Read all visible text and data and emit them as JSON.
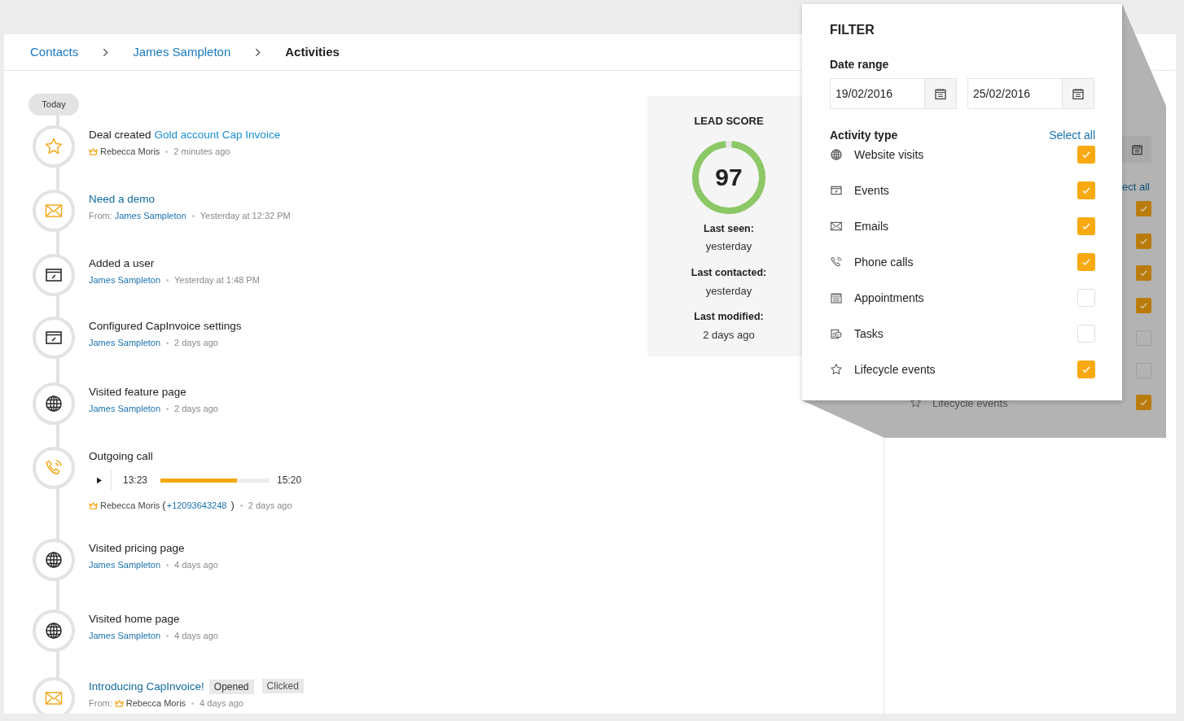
{
  "breadcrumb": [
    {
      "label": "Contacts",
      "kind": "link"
    },
    {
      "label": "James Sampleton",
      "kind": "link"
    },
    {
      "label": "Activities",
      "kind": "current"
    }
  ],
  "timeline": {
    "date_label": "Today",
    "activities": [
      {
        "kind": "deal",
        "title": "Deal created",
        "title_link": "Gold account Cap Invoice",
        "person": {
          "name": "Rebecca Moris",
          "kind": "user"
        },
        "time": "2 minutes ago"
      },
      {
        "kind": "email",
        "title_link": "Need a demo",
        "from_label": "From:",
        "person": {
          "name": "James Sampleton",
          "kind": "contact"
        },
        "time": "Yesterday at 12:32 PM"
      },
      {
        "kind": "event",
        "title": "Added a user",
        "person": {
          "name": "James Sampleton",
          "kind": "contact"
        },
        "time": "Yesterday at 1:48 PM"
      },
      {
        "kind": "event",
        "title": "Configured CapInvoice settings",
        "person": {
          "name": "James Sampleton",
          "kind": "contact"
        },
        "time": "2 days ago"
      },
      {
        "kind": "visit",
        "title": "Visited feature page",
        "person": {
          "name": "James Sampleton",
          "kind": "contact"
        },
        "time": "2 days ago"
      },
      {
        "kind": "call",
        "title": "Outgoing call",
        "call": {
          "start": "13:23",
          "level": 0.7,
          "end": "15:20"
        },
        "person": {
          "name": "Rebecca Moris",
          "kind": "user"
        },
        "phone_open": "(",
        "phone": "+12093643248",
        "phone_close": ")",
        "time": "2 days ago"
      },
      {
        "kind": "visit",
        "title": "Visited pricing page",
        "person": {
          "name": "James Sampleton",
          "kind": "contact"
        },
        "time": "4 days ago"
      },
      {
        "kind": "visit",
        "title": "Visited home  page",
        "person": {
          "name": "James Sampleton",
          "kind": "contact"
        },
        "time": "4 days ago"
      },
      {
        "kind": "email",
        "title_link": "Introducing CapInvoice!",
        "badges": [
          "Opened",
          "Clicked"
        ],
        "from_label": "From:",
        "person": {
          "name": "Rebecca Moris",
          "kind": "user"
        },
        "time": "4 days ago"
      }
    ]
  },
  "lead_score": {
    "title": "LEAD SCORE",
    "score": "97",
    "level": 0.97,
    "stats": [
      {
        "label": "Last seen:",
        "value": "yesterday"
      },
      {
        "label": "Last contacted:",
        "value": "yesterday"
      },
      {
        "label": "Last modified:",
        "value": "2 days ago"
      }
    ]
  },
  "filter": {
    "title": "FILTER",
    "date_range_label": "Date range",
    "dates": [
      "19/02/2016",
      "25/02/2016"
    ],
    "activity_type_label": "Activity type",
    "select_all": "Select all",
    "types": [
      {
        "kind": "visit",
        "label": "Website visits",
        "checked": true
      },
      {
        "kind": "event",
        "label": "Events",
        "checked": true
      },
      {
        "kind": "email",
        "label": "Emails",
        "checked": true
      },
      {
        "kind": "call",
        "label": "Phone calls",
        "checked": true
      },
      {
        "kind": "appointment",
        "label": "Appointments",
        "checked": false
      },
      {
        "kind": "task",
        "label": "Tasks",
        "checked": false
      },
      {
        "kind": "deal",
        "label": "Lifecycle events",
        "checked": true
      }
    ]
  },
  "shadowed_panel": {
    "select_all_fragment": "ect all",
    "last_label": "Lifecycle events",
    "checkboxes": [
      {
        "checked": true
      },
      {
        "checked": true
      },
      {
        "checked": true
      },
      {
        "checked": true
      },
      {
        "checked": false
      },
      {
        "checked": false
      },
      {
        "checked": true
      }
    ]
  }
}
